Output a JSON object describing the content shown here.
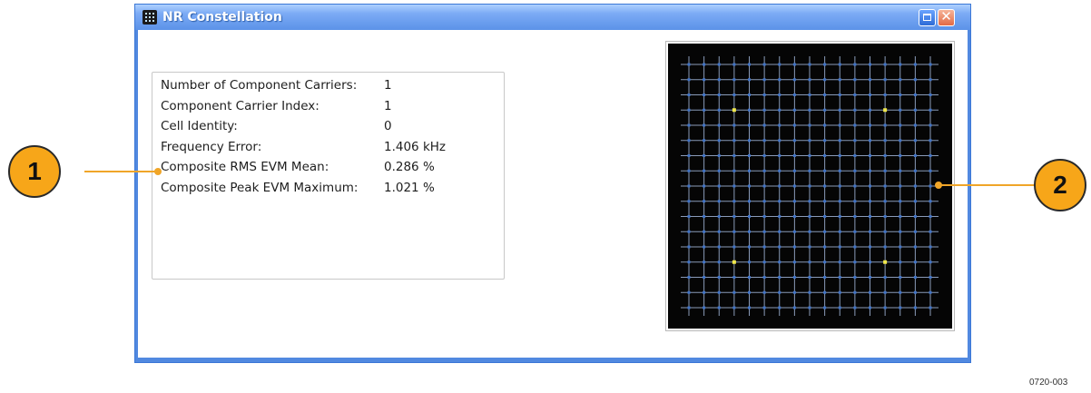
{
  "window": {
    "title": "NR Constellation",
    "icons": {
      "app": "analyzer-app-icon",
      "maximize": "maximize-icon",
      "close": "close-icon",
      "close_glyph": "✕"
    }
  },
  "summary": {
    "rows": [
      {
        "label": "Number of Component Carriers:",
        "value": "1"
      },
      {
        "label": "Component Carrier Index:",
        "value": "1"
      },
      {
        "label": "Cell Identity:",
        "value": "0"
      },
      {
        "label": "Frequency Error:",
        "value": "1.406 kHz"
      },
      {
        "label": "Composite RMS EVM Mean:",
        "value": "0.286 %"
      },
      {
        "label": "Composite Peak EVM Maximum:",
        "value": "1.021 %"
      }
    ]
  },
  "constellation": {
    "grid_size": 17,
    "colors": {
      "background": "#050505",
      "grid": "#8a9bb8",
      "points": "#3f73c8",
      "highlight": "#f2e94a"
    },
    "highlighted_points": [
      [
        3,
        3
      ],
      [
        13,
        3
      ],
      [
        3,
        13
      ],
      [
        13,
        13
      ]
    ]
  },
  "callouts": [
    {
      "number": "1"
    },
    {
      "number": "2"
    }
  ],
  "colors": {
    "callout_fill": "#f7a619",
    "title_bar": "#5b92e8",
    "window_border": "#3b77d6"
  },
  "figure_id": "0720-003"
}
